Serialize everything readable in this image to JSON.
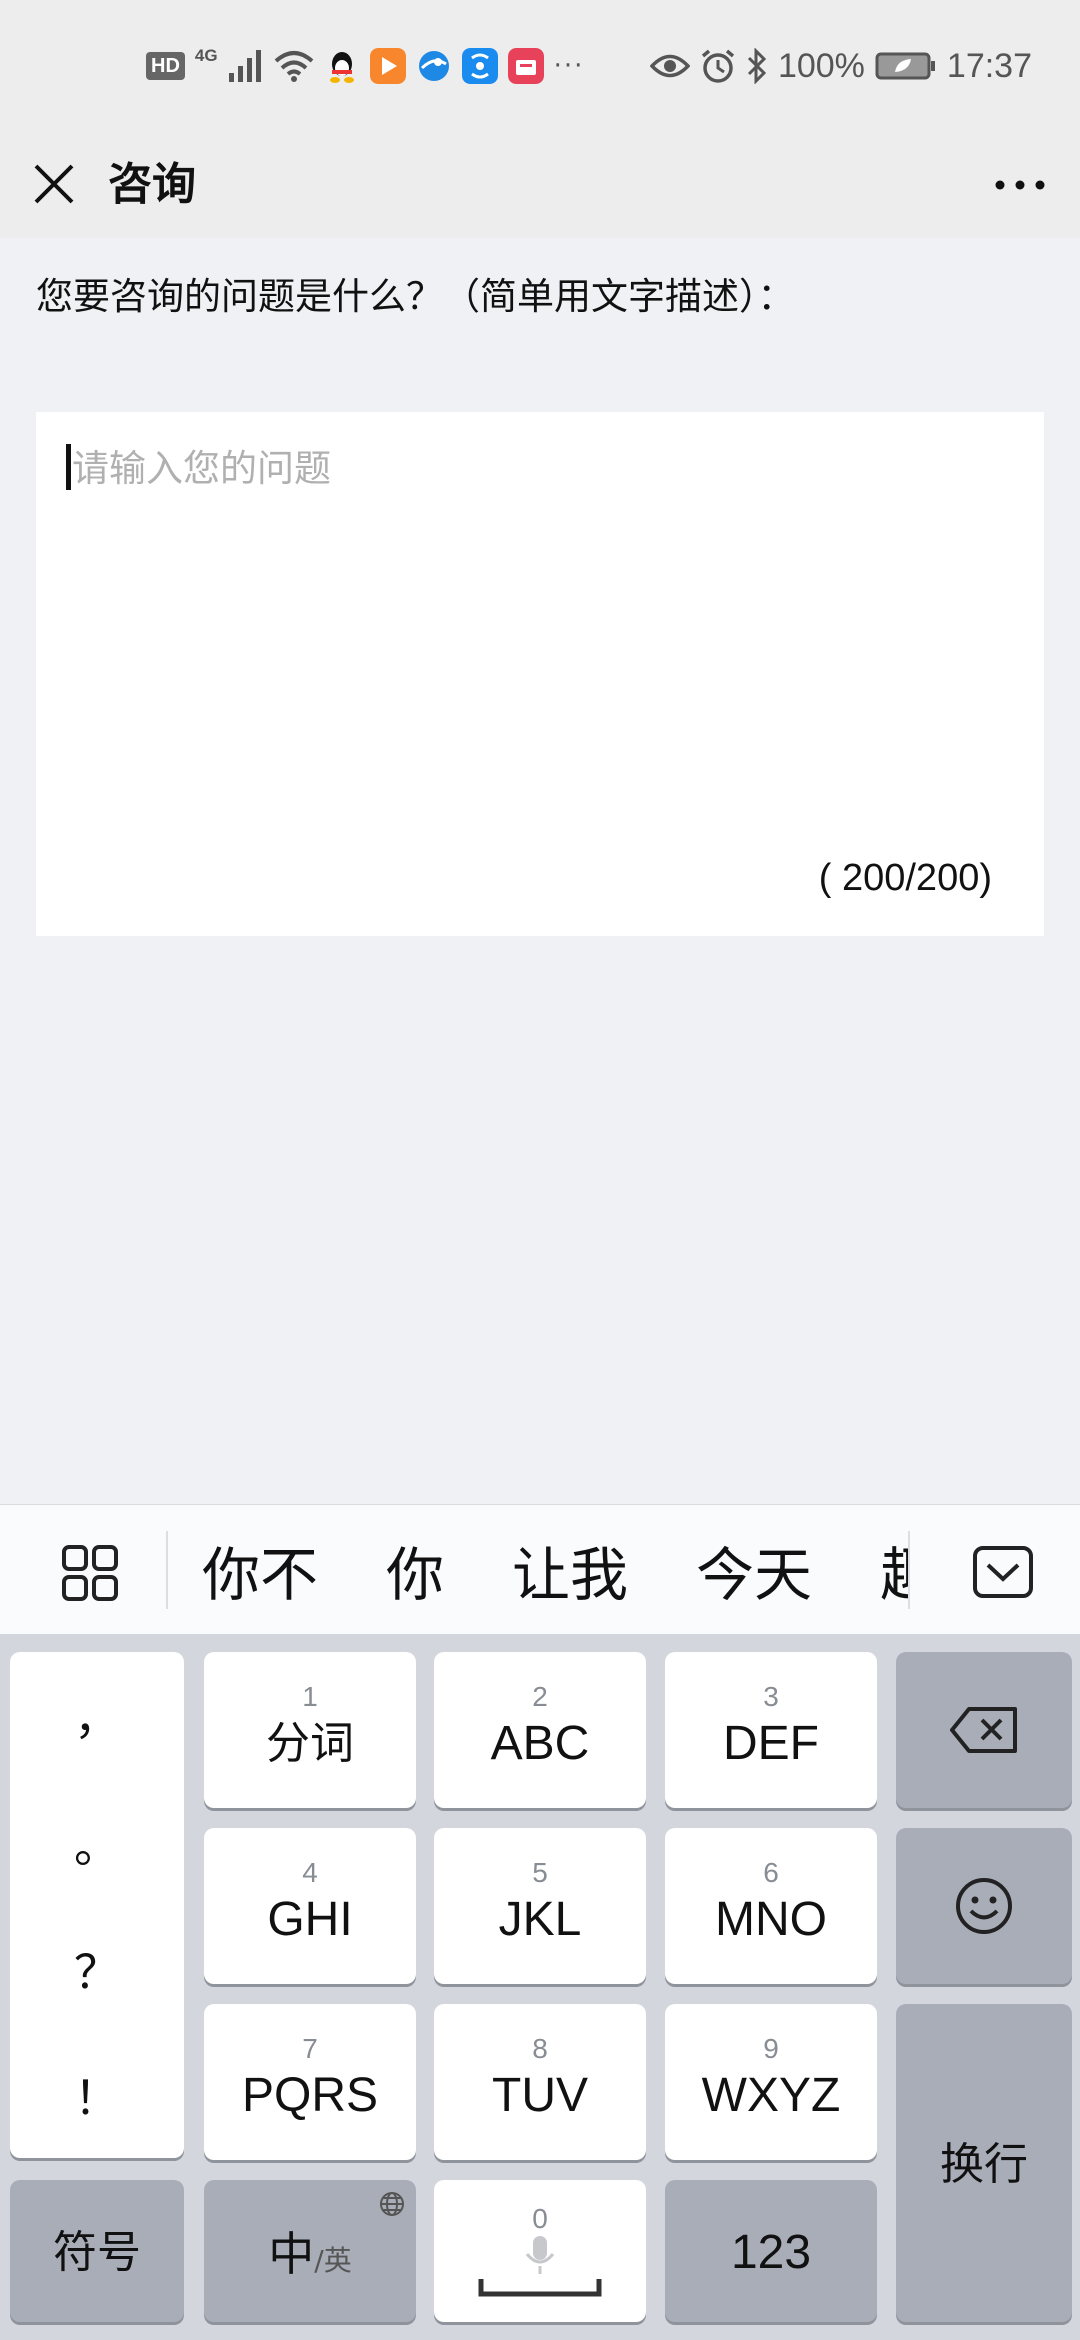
{
  "status_bar": {
    "hd": "HD",
    "network": "4G",
    "more": "···",
    "battery": "100%",
    "time": "17:37"
  },
  "header": {
    "title": "咨询"
  },
  "form": {
    "prompt": "您要咨询的问题是什么？（简单用文字描述）：",
    "placeholder": "请输入您的问题",
    "counter": "( 200/200)"
  },
  "candidates": {
    "items": [
      "你不",
      "你",
      "让我",
      "今天",
      "趣"
    ]
  },
  "keyboard": {
    "punctuation": [
      "，",
      "。",
      "？",
      "！"
    ],
    "rows": [
      [
        {
          "num": "1",
          "label": "分词"
        },
        {
          "num": "2",
          "label": "ABC"
        },
        {
          "num": "3",
          "label": "DEF"
        }
      ],
      [
        {
          "num": "4",
          "label": "GHI"
        },
        {
          "num": "5",
          "label": "JKL"
        },
        {
          "num": "6",
          "label": "MNO"
        }
      ],
      [
        {
          "num": "7",
          "label": "PQRS"
        },
        {
          "num": "8",
          "label": "TUV"
        },
        {
          "num": "9",
          "label": "WXYZ"
        }
      ]
    ],
    "symbols": "符号",
    "lang_main": "中",
    "lang_sub": "/英",
    "space_num": "0",
    "numbers": "123",
    "enter": "换行"
  },
  "colors": {
    "background": "#f0f1f4",
    "header": "#ededed",
    "keyboard": "#d3d6dd",
    "dark_key": "#a8adb8",
    "light_key": "#ffffff"
  },
  "icons": {
    "close": "close-icon",
    "more": "more-dots-icon",
    "grid": "grid-icon",
    "collapse": "keyboard-collapse-icon",
    "backspace": "backspace-icon",
    "emoji": "emoji-icon",
    "mic": "microphone-icon",
    "globe": "globe-icon"
  }
}
